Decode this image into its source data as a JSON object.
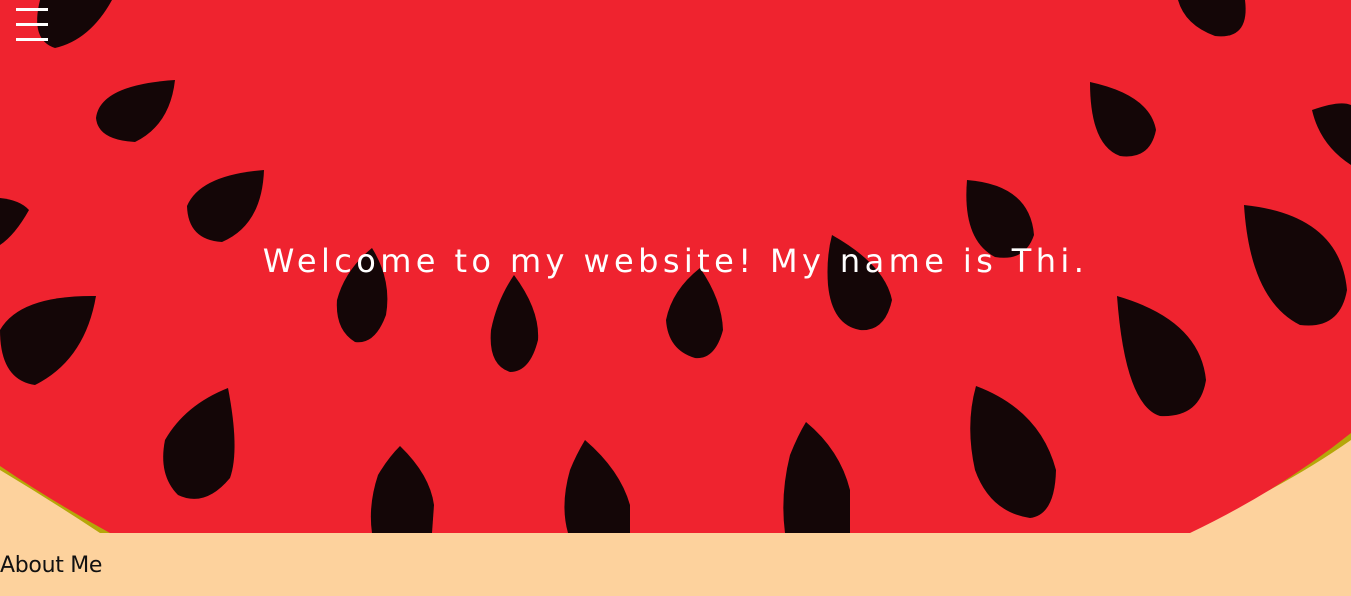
{
  "nav": {
    "menu_icon": "hamburger-menu-icon"
  },
  "hero": {
    "title": "Welcome to my website! My name is Thi.",
    "background_art": "watermelon-slice-illustration",
    "colors": {
      "flesh": "#ef232f",
      "seeds": "#140607",
      "rind": "#b5a709",
      "page_background": "#fdd29d",
      "title_text": "#ffffff"
    }
  },
  "about": {
    "heading": "About Me"
  }
}
